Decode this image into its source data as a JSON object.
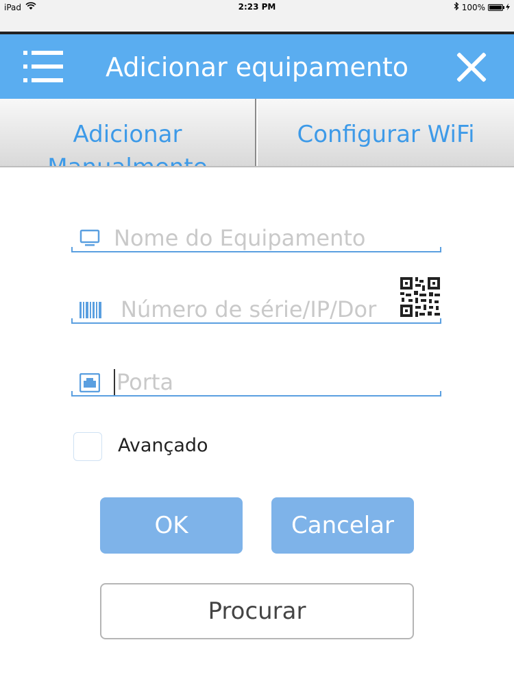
{
  "status_bar": {
    "device": "iPad",
    "time": "2:23 PM",
    "battery": "100%",
    "battery_level": 1.0,
    "icons": [
      "wifi-icon",
      "bluetooth-icon",
      "battery-icon",
      "charging-icon"
    ]
  },
  "header": {
    "title": "Adicionar equipamento",
    "menu_icon": "menu-icon",
    "close_icon": "close-icon",
    "color": "#5aadf0"
  },
  "tabs": [
    {
      "label": "Adicionar Manualmente",
      "selected": true
    },
    {
      "label": "Configurar WiFi",
      "selected": false
    }
  ],
  "form": {
    "device_name": {
      "placeholder": "Nome do Equipamento",
      "value": "",
      "icon": "monitor-icon"
    },
    "serial": {
      "placeholder": "Número de série/IP/Dor",
      "value": "",
      "icon": "barcode-icon",
      "qr_icon": "qr-code-icon"
    },
    "port": {
      "placeholder": "Porta",
      "value": "",
      "icon": "port-icon"
    },
    "advanced": {
      "label": "Avançado",
      "checked": false
    }
  },
  "buttons": {
    "ok": "OK",
    "cancel": "Cancelar",
    "search": "Procurar"
  },
  "colors": {
    "accent": "#5aadf0",
    "tab_text": "#3d9ae8",
    "button": "#7eb3e9",
    "field_line": "#5a9fe0"
  }
}
